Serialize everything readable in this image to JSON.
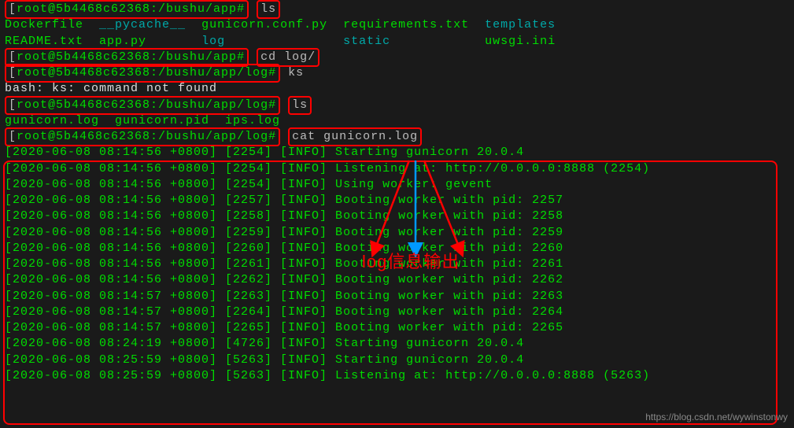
{
  "prompts": [
    {
      "user": "root@5b4468c62368",
      "path": ":/bushu/app#",
      "cmd": "ls",
      "boxCmd": true,
      "boxPrompt": true
    },
    {
      "user": "root@5b4468c62368",
      "path": ":/bushu/app#",
      "cmd": "cd log/",
      "boxCmd": true,
      "boxPrompt": true
    },
    {
      "user": "root@5b4468c62368",
      "path": ":/bushu/app/log#",
      "cmd": "ks",
      "boxCmd": false,
      "boxPrompt": true
    },
    {
      "user": "root@5b4468c62368",
      "path": ":/bushu/app/log#",
      "cmd": "ls",
      "boxCmd": true,
      "boxPrompt": true
    },
    {
      "user": "root@5b4468c62368",
      "path": ":/bushu/app/log#",
      "cmd": "cat gunicorn.log",
      "boxCmd": true,
      "boxPrompt": true
    }
  ],
  "ls1": {
    "row1": "Dockerfile  __pycache__  gunicorn.conf.py  requirements.txt  templates",
    "row2": "README.txt  app.py       log               static            uwsgi.ini",
    "dirs": [
      "__pycache__",
      "log",
      "templates",
      "static"
    ]
  },
  "bashError": "bash: ks: command not found",
  "ls2": "gunicorn.log  gunicorn.pid  ips.log",
  "logLines": [
    "[2020-06-08 08:14:56 +0800] [2254] [INFO] Starting gunicorn 20.0.4",
    "[2020-06-08 08:14:56 +0800] [2254] [INFO] Listening at: http://0.0.0.0:8888 (2254)",
    "[2020-06-08 08:14:56 +0800] [2254] [INFO] Using worker: gevent",
    "[2020-06-08 08:14:56 +0800] [2257] [INFO] Booting worker with pid: 2257",
    "[2020-06-08 08:14:56 +0800] [2258] [INFO] Booting worker with pid: 2258",
    "[2020-06-08 08:14:56 +0800] [2259] [INFO] Booting worker with pid: 2259",
    "[2020-06-08 08:14:56 +0800] [2260] [INFO] Booting worker with pid: 2260",
    "[2020-06-08 08:14:56 +0800] [2261] [INFO] Booting worker with pid: 2261",
    "[2020-06-08 08:14:56 +0800] [2262] [INFO] Booting worker with pid: 2262",
    "[2020-06-08 08:14:57 +0800] [2263] [INFO] Booting worker with pid: 2263",
    "[2020-06-08 08:14:57 +0800] [2264] [INFO] Booting worker with pid: 2264",
    "[2020-06-08 08:14:57 +0800] [2265] [INFO] Booting worker with pid: 2265",
    "[2020-06-08 08:24:19 +0800] [4726] [INFO] Starting gunicorn 20.0.4",
    "[2020-06-08 08:25:59 +0800] [5263] [INFO] Starting gunicorn 20.0.4",
    "[2020-06-08 08:25:59 +0800] [5263] [INFO] Listening at: http://0.0.0.0:8888 (5263)"
  ],
  "annotation": "log信息输出",
  "watermark": "https://blog.csdn.net/wywinstonwy"
}
